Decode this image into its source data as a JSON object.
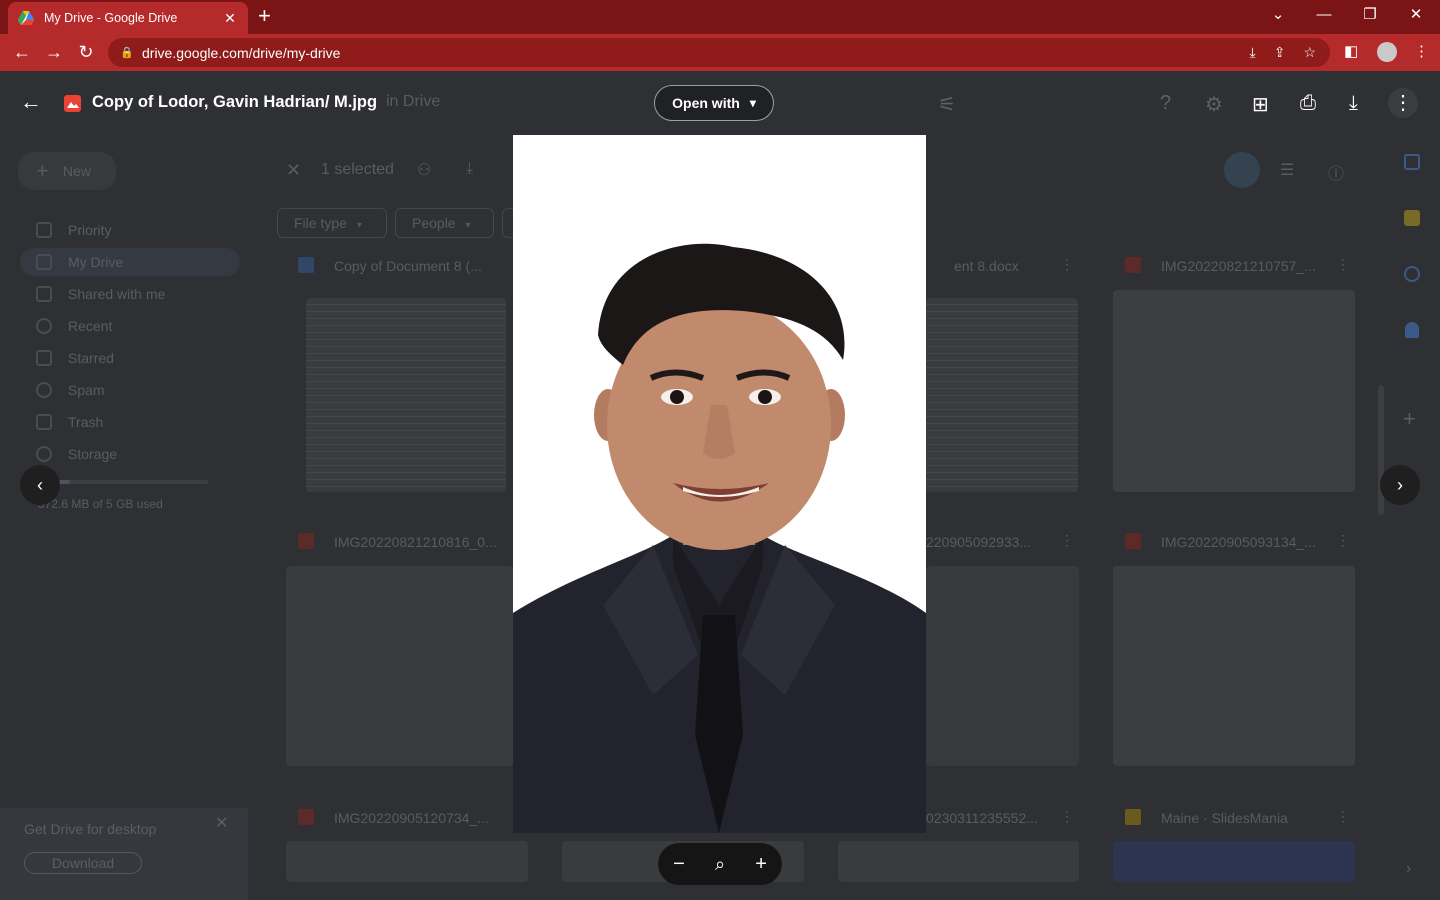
{
  "browser": {
    "tab_title": "My Drive - Google Drive",
    "tab_close": "✕",
    "new_tab": "+",
    "url": "drive.google.com/drive/my-drive",
    "window": {
      "minimize": "—",
      "restore": "❐",
      "close": "✕",
      "dropdown": "⌄"
    },
    "nav": {
      "back": "←",
      "forward": "→",
      "reload": "↻"
    },
    "toolbar_icons": {
      "install": "⤓",
      "share": "⇪",
      "bookmark": "☆",
      "sidepanel": "◧",
      "menu": "⋮"
    },
    "lock": "🔒"
  },
  "drive_background": {
    "new_button": "New",
    "sidebar": [
      "Priority",
      "My Drive",
      "Shared with me",
      "Recent",
      "Starred",
      "Spam",
      "Trash",
      "Storage"
    ],
    "storage_used": "572.6 MB of 5 GB used",
    "search_fragment": "in Drive",
    "selection": {
      "count": "1 selected"
    },
    "filters": [
      "File type",
      "People"
    ],
    "files": [
      "Copy of Document 8 (...",
      "ent 8.docx",
      "IMG20220821210757_...",
      "IMG20220821210816_0...",
      "220905092933...",
      "IMG20220905093134_...",
      "IMG20220905120734_...",
      "0230311235552...",
      "Maine · SlidesMania"
    ],
    "banner": {
      "title": "Get Drive for desktop",
      "button": "Download",
      "close": "✕"
    }
  },
  "viewer": {
    "back": "←",
    "file_title": "Copy of Lodor, Gavin Hadrian/ M.jpg",
    "open_with": "Open with",
    "open_with_caret": "▾",
    "icons": {
      "add_comment": "⊞",
      "print": "⎙",
      "download": "⤓",
      "more": "⋮"
    },
    "prev": "‹",
    "next": "›",
    "zoom": {
      "out": "−",
      "reset": "⌕",
      "in": "+"
    }
  }
}
